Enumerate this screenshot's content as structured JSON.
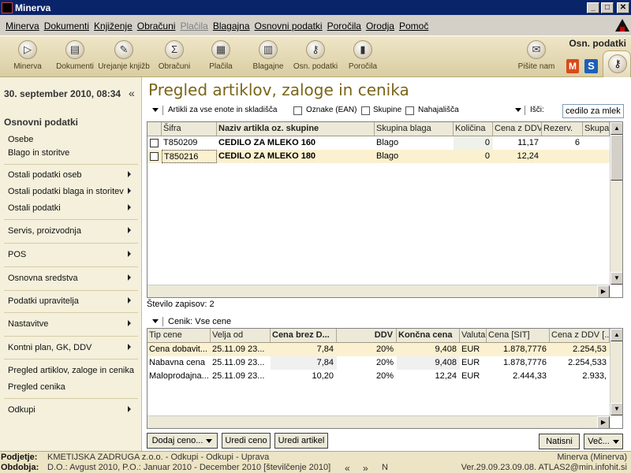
{
  "window": {
    "title": "Minerva",
    "min": "_",
    "max": "□",
    "close": "✕"
  },
  "menu": [
    "Minerva",
    "Dokumenti",
    "Knjiženje",
    "Obračuni",
    "Plačila",
    "Blagajna",
    "Osnovni podatki",
    "Poročila",
    "Orodja",
    "Pomoč"
  ],
  "menu_disabled": [
    "Plačila"
  ],
  "toolbar": {
    "heading": "Osn. podatki",
    "buttons": [
      {
        "label": "Minerva",
        "icon": "play-icon"
      },
      {
        "label": "Dokumenti",
        "icon": "document-icon"
      },
      {
        "label": "Urejanje knjižb",
        "icon": "book-edit-icon"
      },
      {
        "label": "Obračuni",
        "icon": "calculation-icon"
      },
      {
        "label": "Plačila",
        "icon": "payment-icon"
      },
      {
        "label": "Blagajne",
        "icon": "cashbox-icon"
      },
      {
        "label": "Osn. podatki",
        "icon": "key-icon"
      },
      {
        "label": "Poročila",
        "icon": "chart-icon"
      },
      {
        "label": "Pišite nam",
        "icon": "mail-icon"
      }
    ]
  },
  "sidebar": {
    "date": "30. september 2010, 08:34",
    "section_title": "Osnovni podatki",
    "items": [
      {
        "label": "Osebe",
        "arrow": false
      },
      {
        "label": "Blago in storitve",
        "arrow": false
      },
      {
        "label": "Ostali podatki oseb",
        "arrow": true
      },
      {
        "label": "Ostali podatki blaga in storitev",
        "arrow": true
      },
      {
        "label": "Ostali podatki",
        "arrow": true
      },
      {
        "label": "Servis, proizvodnja",
        "arrow": true
      },
      {
        "label": "POS",
        "arrow": true
      },
      {
        "label": "Osnovna sredstva",
        "arrow": true
      },
      {
        "label": "Podatki upravitelja",
        "arrow": true
      },
      {
        "label": "Nastavitve",
        "arrow": true
      },
      {
        "label": "Kontni plan, GK, DDV",
        "arrow": true
      },
      {
        "label": "Pregled artiklov, zaloge in cenika",
        "arrow": false
      },
      {
        "label": "Pregled cenika",
        "arrow": false
      },
      {
        "label": "Odkupi",
        "arrow": true
      }
    ]
  },
  "main": {
    "title": "Pregled artiklov, zaloge in cenika",
    "filter": {
      "scope_label": "Artikli za vse enote in skladišča",
      "cb_ean": "Oznake (EAN)",
      "cb_groups": "Skupine",
      "cb_locations": "Nahajališča",
      "search_label": "Išči:",
      "search_value": "cedilo za mleko"
    },
    "articles": {
      "columns": [
        "Šifra",
        "Naziv artikla oz. skupine",
        "Skupina blaga",
        "Količina",
        "Cena z DDV",
        "Rezerv.",
        "Skupaj"
      ],
      "rows": [
        {
          "sifra": "T850209",
          "naziv": "CEDILO ZA MLEKO 160",
          "skupina": "Blago",
          "kolicina": "0",
          "cena": "11,17",
          "rezerv": "6",
          "skupaj": ""
        },
        {
          "sifra": "T850216",
          "naziv": "CEDILO ZA MLEKO 180",
          "skupina": "Blago",
          "kolicina": "0",
          "cena": "12,24",
          "rezerv": "",
          "skupaj": ""
        }
      ],
      "count_label": "Število zapisov:",
      "count_value": "2"
    },
    "cenik": {
      "label": "Cenik: Vse cene",
      "columns": [
        "Tip cene",
        "Velja od",
        "Cena brez D...",
        "DDV",
        "Končna cena",
        "Valuta",
        "Cena [SIT]",
        "Cena z DDV [..."
      ],
      "rows": [
        {
          "tip": "Cena dobavit...",
          "velja": "25.11.09 23...",
          "cena_brez": "7,84",
          "ddv": "20%",
          "koncna": "9,408",
          "valuta": "EUR",
          "sit": "1.878,7776",
          "z_ddv": "2.254,53"
        },
        {
          "tip": "Nabavna cena",
          "velja": "25.11.09 23...",
          "cena_brez": "7,84",
          "ddv": "20%",
          "koncna": "9,408",
          "valuta": "EUR",
          "sit": "1.878,7776",
          "z_ddv": "2.254,533"
        },
        {
          "tip": "Maloprodajna...",
          "velja": "25.11.09 23...",
          "cena_brez": "10,20",
          "ddv": "20%",
          "koncna": "12,24",
          "valuta": "EUR",
          "sit": "2.444,33",
          "z_ddv": "2.933,"
        }
      ]
    },
    "buttons": {
      "add_price": "Dodaj ceno...",
      "edit_price": "Uredi ceno",
      "edit_article": "Uredi artikel",
      "print": "Natisni",
      "more": "Več..."
    }
  },
  "status": {
    "company_label": "Podjetje:",
    "company_value": "KMETIJSKA ZADRUGA z.o.o. - Odkupi - Odkupi - Uprava",
    "period_label": "Obdobja:",
    "period_value": "D.O.: Avgust 2010, P.O.: Januar 2010 - December 2010 [številčenje 2010]",
    "app_name": "Minerva (Minerva)",
    "version": "Ver.29.09.23.09.08. ATLAS2@min.infohit.si",
    "nav_prev": "«",
    "nav_next": "»",
    "nav_n": "N"
  }
}
